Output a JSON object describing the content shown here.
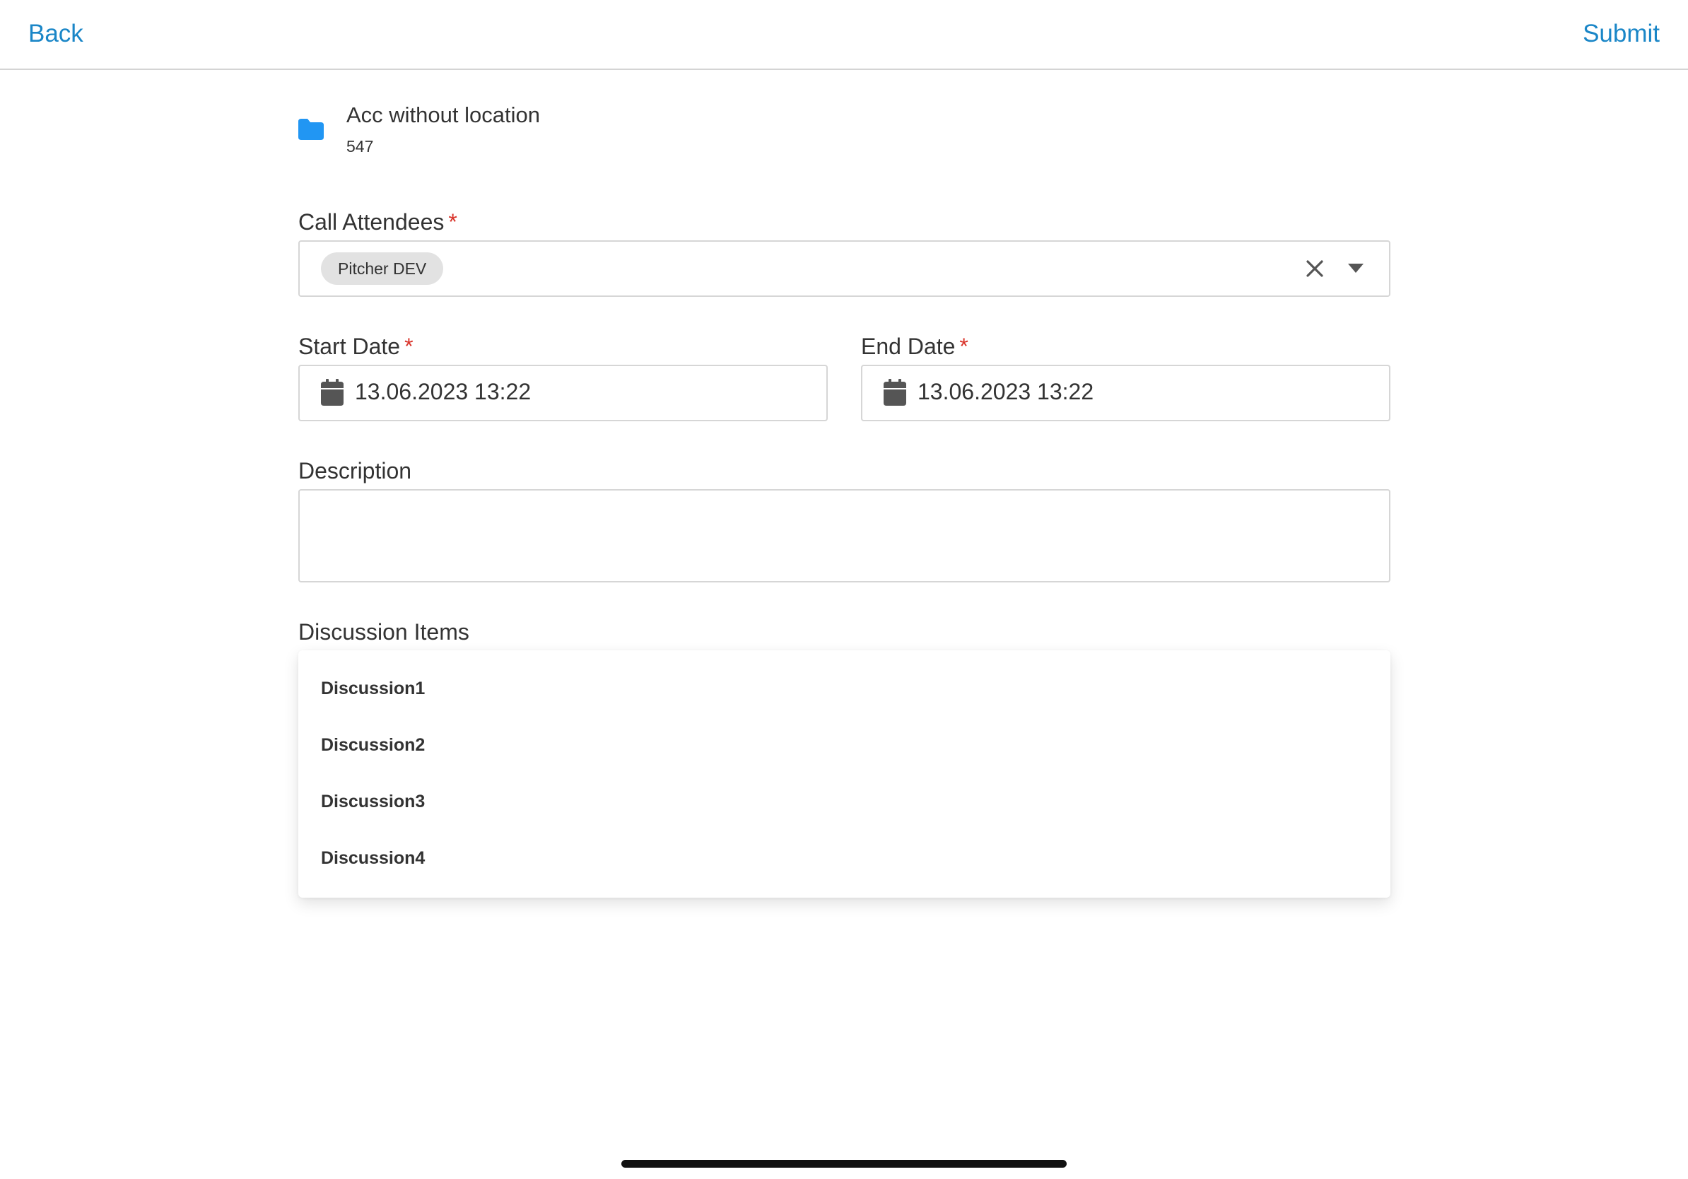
{
  "nav": {
    "back_label": "Back",
    "submit_label": "Submit"
  },
  "account": {
    "name": "Acc without location",
    "number": "547",
    "icon": "folder-icon",
    "icon_color": "#2196f3"
  },
  "attendees": {
    "label": "Call Attendees",
    "required_mark": "*",
    "selected": [
      "Pitcher DEV"
    ]
  },
  "start_date": {
    "label": "Start Date",
    "required_mark": "*",
    "value": "13.06.2023 13:22"
  },
  "end_date": {
    "label": "End Date",
    "required_mark": "*",
    "value": "13.06.2023 13:22"
  },
  "description": {
    "label": "Description",
    "value": ""
  },
  "discussion": {
    "label": "Discussion Items",
    "items": [
      "Discussion1",
      "Discussion2",
      "Discussion3",
      "Discussion4"
    ]
  },
  "colors": {
    "accent": "#1a86c7",
    "required": "#d9342b",
    "chip_bg": "#e2e2e2",
    "border": "#d6d6d6"
  }
}
